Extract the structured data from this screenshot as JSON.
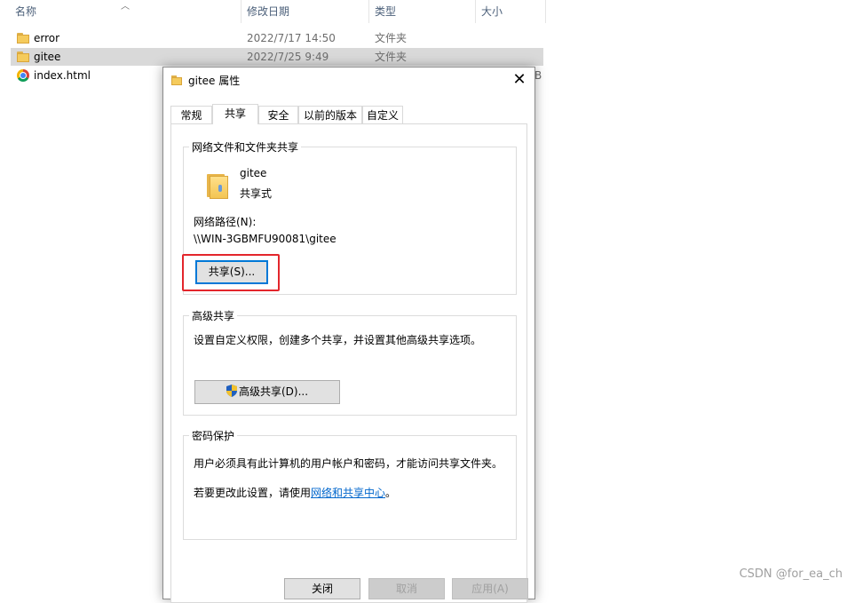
{
  "explorer": {
    "columns": {
      "name": "名称",
      "modified": "修改日期",
      "type": "类型",
      "size": "大小"
    },
    "files": [
      {
        "name": "error",
        "modified": "2022/7/17 14:50",
        "type": "文件夹",
        "icon": "folder-icon",
        "selected": false
      },
      {
        "name": "gitee",
        "modified": "2022/7/25 9:49",
        "type": "文件夹",
        "icon": "folder-icon",
        "selected": true
      },
      {
        "name": "index.html",
        "modified": "",
        "type": "",
        "icon": "chrome-icon",
        "selected": false
      }
    ],
    "partial_size_char": "B"
  },
  "dialog": {
    "title": "gitee 属性",
    "tabs": [
      "常规",
      "共享",
      "安全",
      "以前的版本",
      "自定义"
    ],
    "active_tab": "共享",
    "network_share": {
      "legend": "网络文件和文件夹共享",
      "folder_name": "gitee",
      "share_status": "共享式",
      "path_label": "网络路径(N):",
      "path_value": "\\\\WIN-3GBMFU90081\\gitee",
      "share_button": "共享(S)..."
    },
    "advanced_share": {
      "legend": "高级共享",
      "description": "设置自定义权限，创建多个共享，并设置其他高级共享选项。",
      "button": "高级共享(D)..."
    },
    "password": {
      "legend": "密码保护",
      "line1": "用户必须具有此计算机的用户帐户和密码，才能访问共享文件夹。",
      "line2_prefix": "若要更改此设置，请使用",
      "line2_link": "网络和共享中心",
      "line2_suffix": "。"
    },
    "footer_buttons": {
      "ok": "关闭",
      "cancel": "取消",
      "apply": "应用(A)"
    },
    "colors": {
      "highlight_box": "#e3262c",
      "link": "#0066cc"
    }
  },
  "watermark": "CSDN @for_ea_ch"
}
